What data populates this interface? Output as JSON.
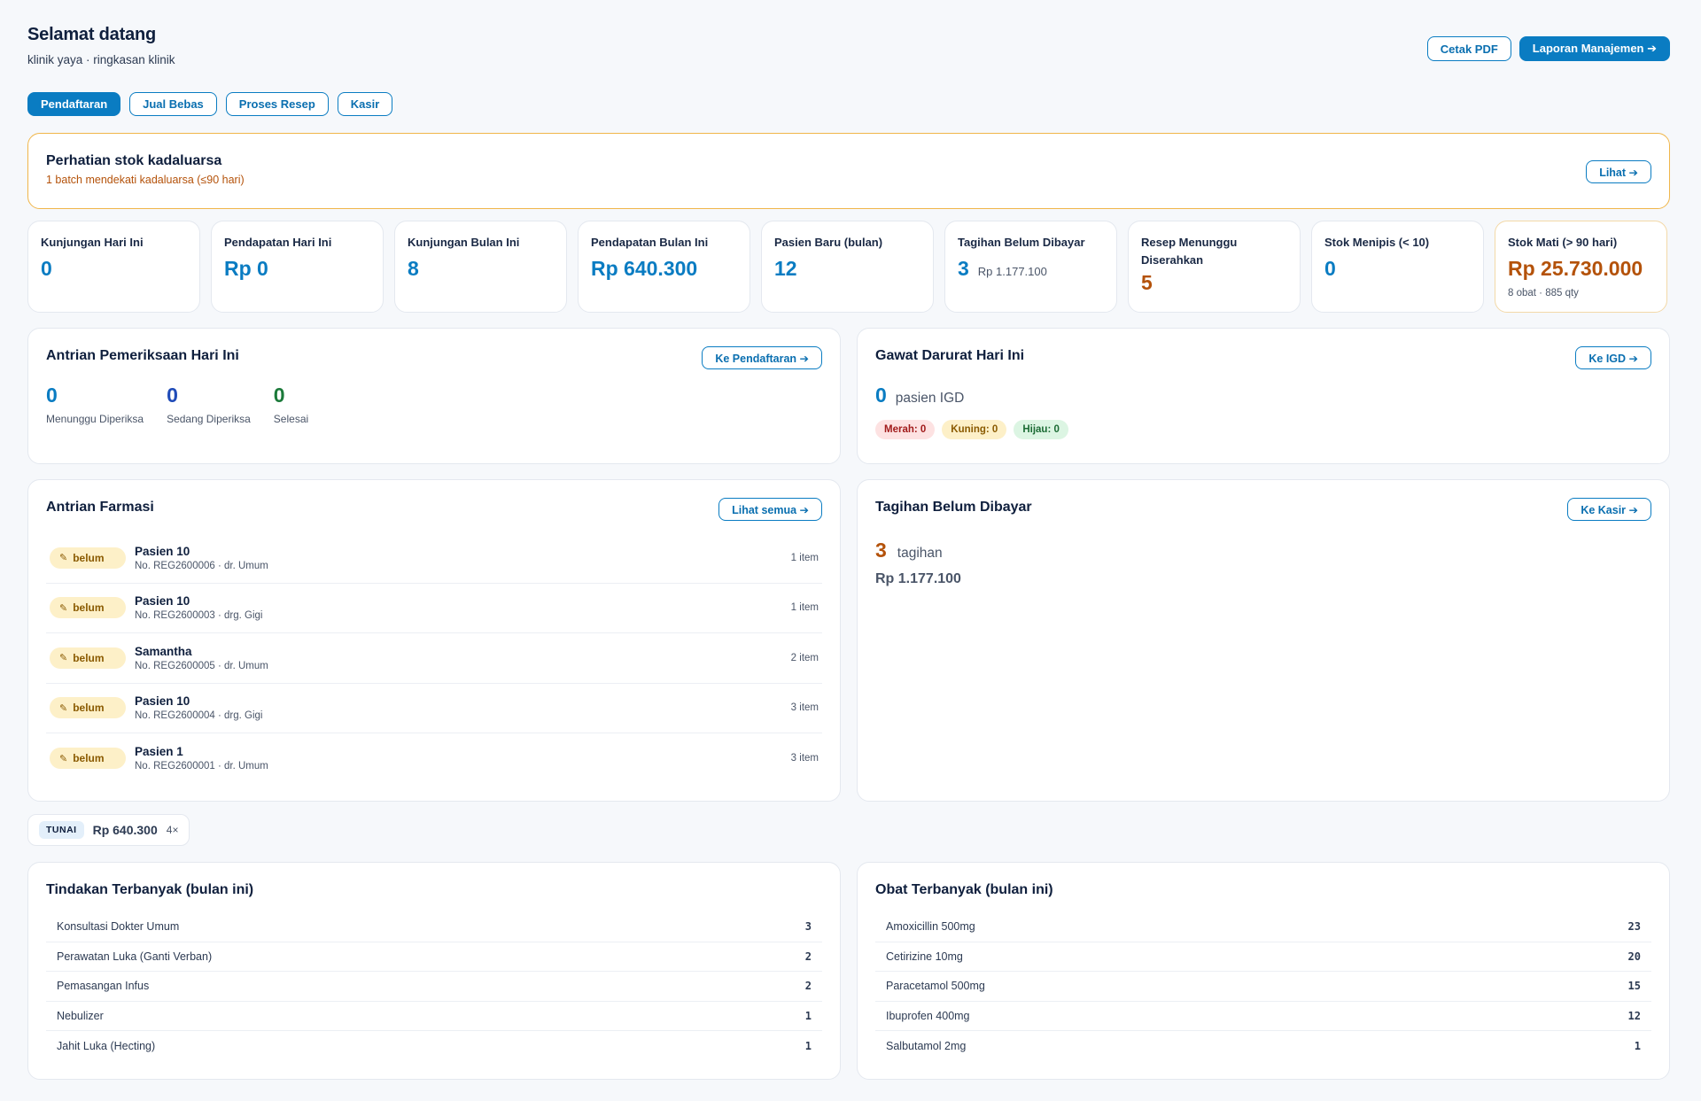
{
  "header": {
    "title": "Selamat datang",
    "subtitle": "klinik yaya · ringkasan klinik",
    "print_pdf": "Cetak PDF",
    "management_report": "Laporan Manajemen ➔"
  },
  "nav": {
    "tabs": [
      {
        "label": "Pendaftaran"
      },
      {
        "label": "Jual Bebas"
      },
      {
        "label": "Proses Resep"
      },
      {
        "label": "Kasir"
      }
    ]
  },
  "alert": {
    "title": "Perhatian stok kadaluarsa",
    "subtitle": "1 batch mendekati kadaluarsa (≤90 hari)",
    "button": "Lihat ➔"
  },
  "stats": [
    {
      "label": "Kunjungan Hari Ini",
      "value": "0"
    },
    {
      "label": "Pendapatan Hari Ini",
      "value": "Rp 0"
    },
    {
      "label": "Kunjungan Bulan Ini",
      "value": "8"
    },
    {
      "label": "Pendapatan Bulan Ini",
      "value": "Rp 640.300"
    },
    {
      "label": "Pasien Baru (bulan)",
      "value": "12"
    },
    {
      "label": "Tagihan Belum Dibayar",
      "value": "3",
      "extra": "Rp 1.177.100"
    },
    {
      "label": "Resep Menunggu Diserahkan",
      "value": "5"
    },
    {
      "label": "Stok Menipis (< 10)",
      "value": "0"
    },
    {
      "label": "Stok Mati (> 90 hari)",
      "value": "Rp 25.730.000",
      "note": "8 obat · 885 qty"
    }
  ],
  "exam_queue": {
    "title": "Antrian Pemeriksaan Hari Ini",
    "button": "Ke Pendaftaran ➔",
    "items": [
      {
        "value": "0",
        "label": "Menunggu Diperiksa",
        "color": "#0a7cc2"
      },
      {
        "value": "0",
        "label": "Sedang Diperiksa",
        "color": "#1f4bb8"
      },
      {
        "value": "0",
        "label": "Selesai",
        "color": "#1b7a3a"
      }
    ]
  },
  "emergency": {
    "title": "Gawat Darurat Hari Ini",
    "button": "Ke IGD ➔",
    "count": "0",
    "count_label": "pasien IGD",
    "red": "Merah: 0",
    "yellow": "Kuning: 0",
    "green": "Hijau: 0"
  },
  "pharmacy": {
    "title": "Antrian Farmasi",
    "button": "Lihat semua ➔",
    "items": [
      {
        "status": "belum",
        "name": "Pasien 10",
        "detail": "No. REG2600006 · dr. Umum",
        "count": "1 item"
      },
      {
        "status": "belum",
        "name": "Pasien 10",
        "detail": "No. REG2600003 · drg. Gigi",
        "count": "1 item"
      },
      {
        "status": "belum",
        "name": "Samantha",
        "detail": "No. REG2600005 · dr. Umum",
        "count": "2 item"
      },
      {
        "status": "belum",
        "name": "Pasien 10",
        "detail": "No. REG2600004 · drg. Gigi",
        "count": "3 item"
      },
      {
        "status": "belum",
        "name": "Pasien 1",
        "detail": "No. REG2600001 · dr. Umum",
        "count": "3 item"
      }
    ]
  },
  "bills": {
    "title": "Tagihan Belum Dibayar",
    "button": "Ke Kasir ➔",
    "count": "3",
    "count_label": "tagihan",
    "amount": "Rp 1.177.100"
  },
  "payment": {
    "method": "TUNAI",
    "amount": "Rp 640.300",
    "count": "4×"
  },
  "top_procedures": {
    "title": "Tindakan Terbanyak (bulan ini)",
    "items": [
      {
        "name": "Konsultasi Dokter Umum",
        "value": "3"
      },
      {
        "name": "Perawatan Luka (Ganti Verban)",
        "value": "2"
      },
      {
        "name": "Pemasangan Infus",
        "value": "2"
      },
      {
        "name": "Nebulizer",
        "value": "1"
      },
      {
        "name": "Jahit Luka (Hecting)",
        "value": "1"
      }
    ]
  },
  "top_drugs": {
    "title": "Obat Terbanyak (bulan ini)",
    "items": [
      {
        "name": "Amoxicillin 500mg",
        "value": "23"
      },
      {
        "name": "Cetirizine 10mg",
        "value": "20"
      },
      {
        "name": "Paracetamol 500mg",
        "value": "15"
      },
      {
        "name": "Ibuprofen 400mg",
        "value": "12"
      },
      {
        "name": "Salbutamol 2mg",
        "value": "1"
      }
    ]
  }
}
